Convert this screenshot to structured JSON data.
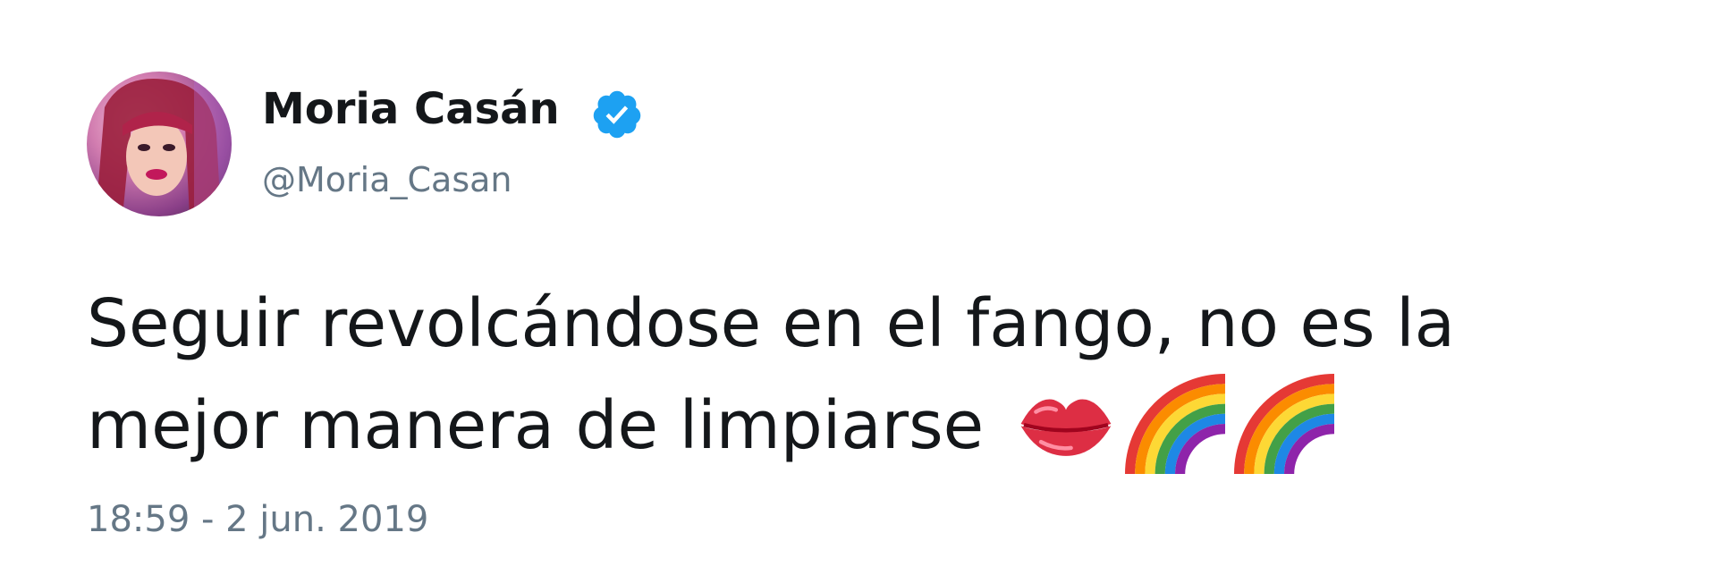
{
  "tweet": {
    "author": {
      "display_name": "Moria Casán",
      "handle": "@Moria_Casan",
      "verified": true,
      "avatar_icon": "profile-photo"
    },
    "text_line_1": "Seguir revolcándose en el fango, no es la",
    "text_line_2": "mejor manera de limpiarse",
    "emojis": [
      "kiss-mark-emoji",
      "rainbow-emoji",
      "rainbow-emoji"
    ],
    "timestamp": "18:59 - 2 jun. 2019"
  },
  "colors": {
    "text": "#14171a",
    "secondary_text": "#657786",
    "verified_blue": "#1da1f2",
    "background": "#ffffff"
  }
}
